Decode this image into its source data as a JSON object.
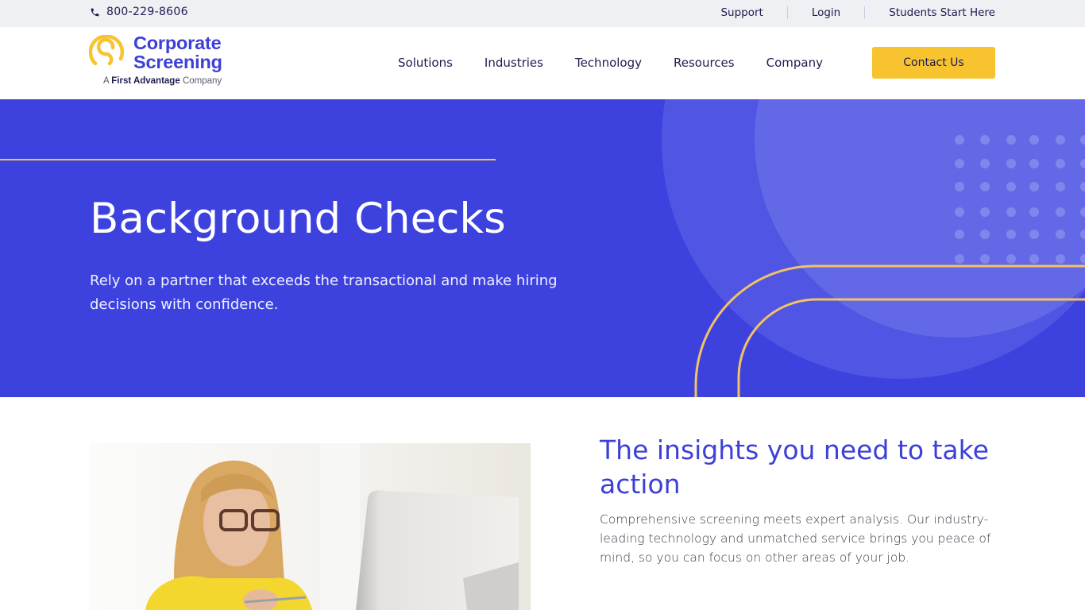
{
  "topbar": {
    "phone": "800-229-8606",
    "links": [
      "Support",
      "Login",
      "Students Start Here"
    ]
  },
  "header": {
    "logo": {
      "line1": "Corporate",
      "line2": "Screening",
      "sub_prefix": "A",
      "sub_brand": "First Advantage",
      "sub_suffix": "Company"
    },
    "nav": [
      "Solutions",
      "Industries",
      "Technology",
      "Resources",
      "Company"
    ],
    "cta": "Contact Us"
  },
  "hero": {
    "title": "Background Checks",
    "subtitle": "Rely on a partner that exceeds the transactional and make hiring decisions with confidence."
  },
  "section": {
    "title": "The insights you need to take action",
    "body": "Comprehensive screening meets expert analysis. Our industry-leading technology and unmatched service brings you peace of mind, so you can focus on other areas of your job.",
    "image_alt": "Woman with glasses in a yellow sweater looking at a computer monitor"
  },
  "colors": {
    "brand_blue": "#3d42df",
    "brand_yellow": "#f7c32e",
    "accent_line": "#f2c265",
    "text_dark": "#1d1d4f"
  }
}
